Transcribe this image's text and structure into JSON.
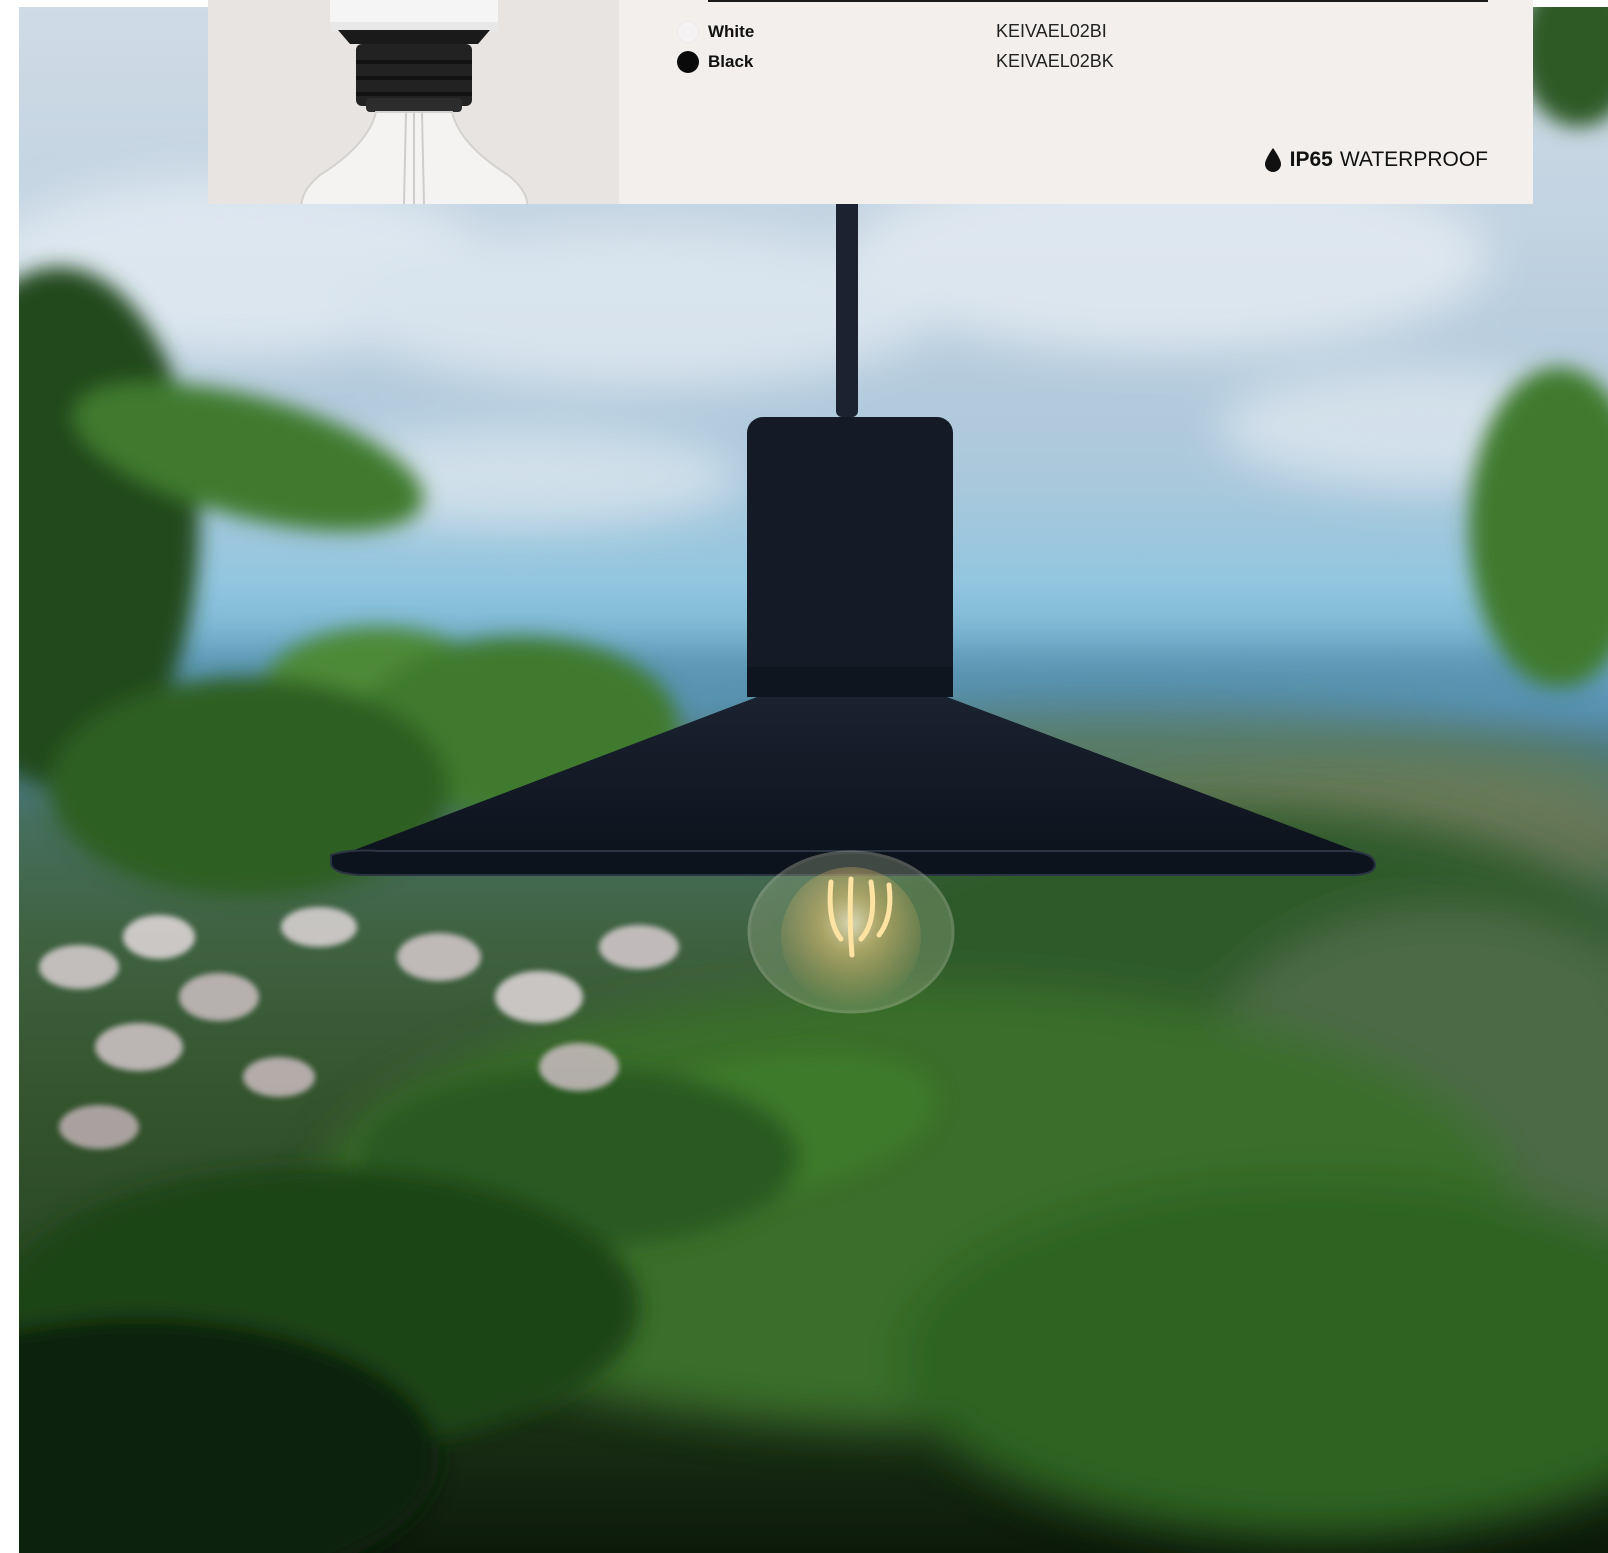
{
  "spec_card": {
    "variants": [
      {
        "color_name": "White",
        "code": "KEIVAEL02BI",
        "swatch": "#f4f2f3"
      },
      {
        "color_name": "Black",
        "code": "KEIVAEL02BK",
        "swatch": "#0a0a0a"
      }
    ],
    "badge": {
      "icon": "water-drop-icon",
      "rating": "IP65",
      "label": "WATERPROOF"
    }
  },
  "photo": {
    "subject": "pendant-lamp-icon"
  }
}
